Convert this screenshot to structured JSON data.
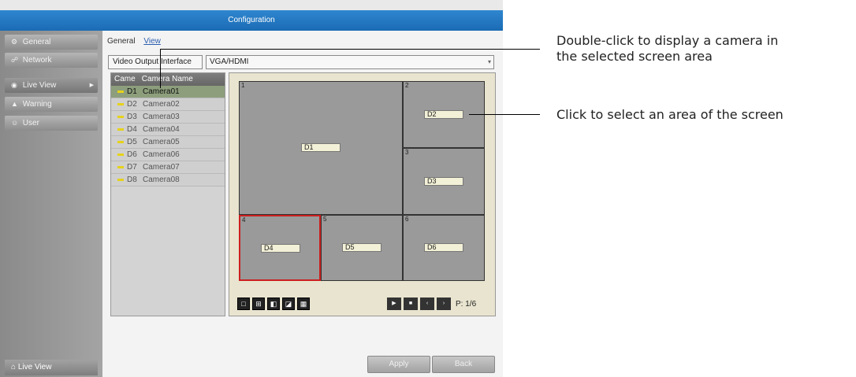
{
  "window": {
    "title": "Configuration"
  },
  "sidebar": {
    "items": [
      {
        "icon": "gear-icon",
        "glyph": "⚙",
        "label": "General"
      },
      {
        "icon": "network-icon",
        "glyph": "☍",
        "label": "Network"
      },
      {
        "icon": "eye-icon",
        "glyph": "◉",
        "label": "Live View"
      },
      {
        "icon": "warning-icon",
        "glyph": "▲",
        "label": "Warning"
      },
      {
        "icon": "user-icon",
        "glyph": "☺",
        "label": "User"
      }
    ],
    "bottom": {
      "icon": "home-icon",
      "glyph": "⌂",
      "label": "Live View"
    }
  },
  "tabs": [
    "General",
    "View"
  ],
  "output": {
    "label": "Video Output Interface",
    "value": "VGA/HDMI"
  },
  "camera_list": {
    "col_no": "Came",
    "col_name": "Camera Name",
    "rows": [
      {
        "id": "D1",
        "name": "Camera01"
      },
      {
        "id": "D2",
        "name": "Camera02"
      },
      {
        "id": "D3",
        "name": "Camera03"
      },
      {
        "id": "D4",
        "name": "Camera04"
      },
      {
        "id": "D5",
        "name": "Camera05"
      },
      {
        "id": "D6",
        "name": "Camera06"
      },
      {
        "id": "D7",
        "name": "Camera07"
      },
      {
        "id": "D8",
        "name": "Camera08"
      }
    ]
  },
  "layout": {
    "cells": [
      {
        "num": "1",
        "cam": "D1"
      },
      {
        "num": "2",
        "cam": "D2"
      },
      {
        "num": "3",
        "cam": "D3"
      },
      {
        "num": "4",
        "cam": "D4"
      },
      {
        "num": "5",
        "cam": "D5"
      },
      {
        "num": "6",
        "cam": "D6"
      }
    ],
    "page": "P: 1/6"
  },
  "buttons": {
    "apply": "Apply",
    "back": "Back"
  },
  "callouts": {
    "double_click": [
      "Double-click to display a camera in",
      "the selected screen area"
    ],
    "click": "Click to select an area of the screen"
  }
}
